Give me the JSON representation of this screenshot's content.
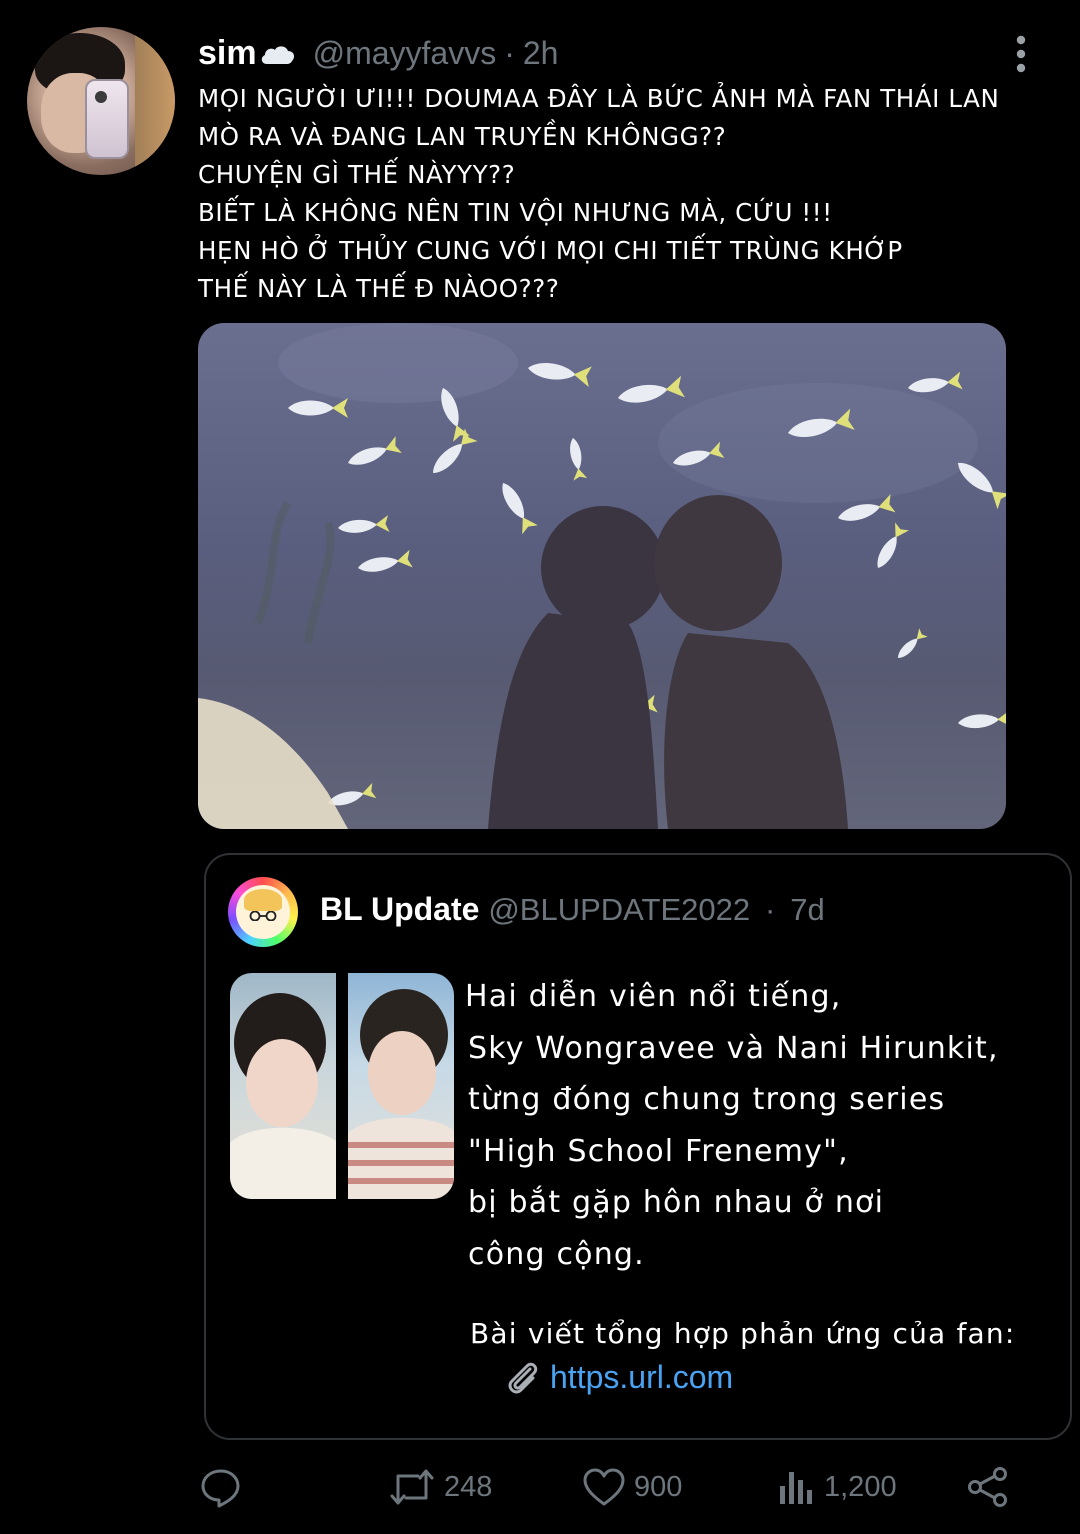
{
  "tweet": {
    "display_name": "sim",
    "name_icon": "cloud-icon",
    "handle": "@mayyfavvs",
    "separator": "·",
    "time": "2h",
    "text_lines": [
      "MỌI NGƯỜI ƯI!!! DOUMAA ĐÂY LÀ BỨC ẢNH MÀ FAN THÁI LAN",
      "MÒ RA VÀ ĐANG LAN TRUYỀN KHÔNGG??",
      "CHUYỆN GÌ THẾ NÀYYY??",
      "BIẾT LÀ KHÔNG NÊN TIN VỘI NHƯNG MÀ, CỨU !!!",
      "HẸN HÒ Ở THỦY CUNG VỚI MỌI CHI TIẾT TRÙNG KHỚP",
      "THẾ NÀY LÀ THẾ Đ NÀOO???"
    ]
  },
  "quote": {
    "display_name": "BL Update",
    "handle": "@BLUPDATE2022",
    "separator": "·",
    "time": "7d",
    "text_lines": [
      "Hai diễn viên nổi tiếng,",
      "Sky Wongravee và Nani Hirunkit,",
      "từng đóng chung trong series",
      "\"High School Frenemy\",",
      "bị bắt gặp hôn nhau ở nơi",
      "công cộng."
    ],
    "footer_text": "Bài viết tổng hợp phản ứng của fan:",
    "link_icon": "paperclip-icon",
    "link_text": "https.url.com"
  },
  "actions": {
    "reply": {
      "icon": "reply-icon",
      "count": ""
    },
    "retweet": {
      "icon": "retweet-icon",
      "count": "248"
    },
    "like": {
      "icon": "heart-icon",
      "count": "900"
    },
    "views": {
      "icon": "views-icon",
      "count": "1,200"
    },
    "share": {
      "icon": "share-icon",
      "count": ""
    }
  },
  "colors": {
    "background": "#000000",
    "text": "#ffffff",
    "secondary": "#6e767d",
    "link": "#4aa3f2",
    "border": "#2f3336"
  }
}
